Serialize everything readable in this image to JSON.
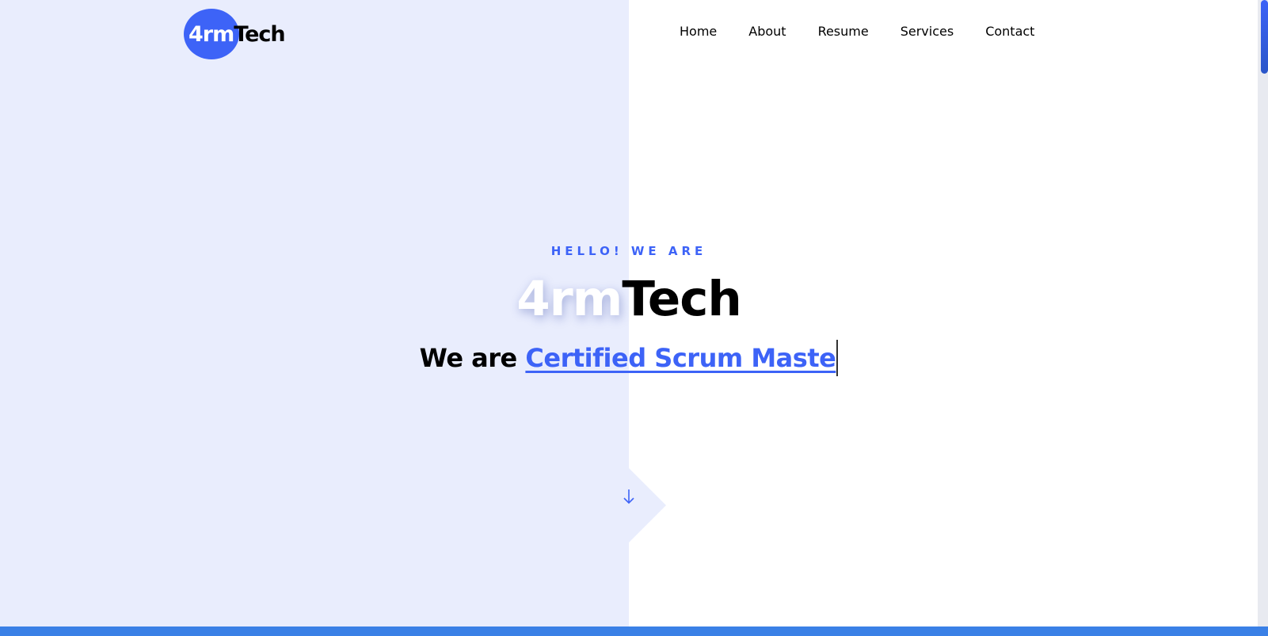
{
  "brand": {
    "logo_part1": "4rm",
    "logo_part2": "Tech",
    "accent_color": "#3d63f7",
    "left_panel_color": "#e9edfd"
  },
  "nav": {
    "items": [
      {
        "label": "Home"
      },
      {
        "label": "About"
      },
      {
        "label": "Resume"
      },
      {
        "label": "Services"
      },
      {
        "label": "Contact"
      }
    ]
  },
  "hero": {
    "eyebrow": "HELLO! WE ARE",
    "title_part1": "4rm",
    "title_part2": "Tech",
    "subtitle_prefix": "We are ",
    "subtitle_typed": "Certified Scrum Maste"
  },
  "scroll": {
    "icon": "arrow-down-icon"
  }
}
